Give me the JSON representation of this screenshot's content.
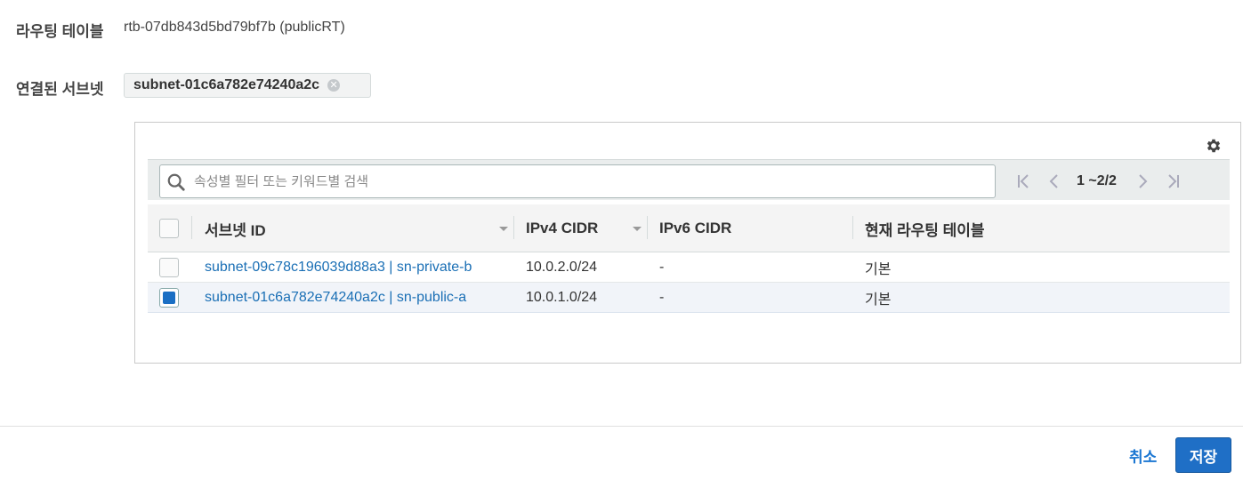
{
  "route_table": {
    "label": "라우팅 테이블",
    "value": "rtb-07db843d5bd79bf7b (publicRT)"
  },
  "associated_subnets": {
    "label": "연결된 서브넷",
    "token": "subnet-01c6a782e74240a2c"
  },
  "search": {
    "placeholder": "속성별 필터 또는 키워드별 검색",
    "value": ""
  },
  "pagination": {
    "text": "1 ~2/2"
  },
  "table": {
    "columns": [
      "서브넷 ID",
      "IPv4 CIDR",
      "IPv6 CIDR",
      "현재 라우팅 테이블"
    ],
    "rows": [
      {
        "subnet": "subnet-09c78c196039d88a3 | sn-private-b",
        "ipv4": "10.0.2.0/24",
        "ipv6": "-",
        "route_table": "기본",
        "checked": false
      },
      {
        "subnet": "subnet-01c6a782e74240a2c | sn-public-a",
        "ipv4": "10.0.1.0/24",
        "ipv6": "-",
        "route_table": "기본",
        "checked": true
      }
    ]
  },
  "footer": {
    "cancel_label": "취소",
    "save_label": "저장"
  },
  "icons": [
    "gear-icon",
    "search-icon",
    "first-page-icon",
    "prev-page-icon",
    "next-page-icon",
    "last-page-icon",
    "sort-caret-icon",
    "token-remove-icon"
  ],
  "colors": {
    "link": "#1a6fb5",
    "primary": "#1f6fc6",
    "checkbox_checked": "#1a6fc4",
    "selected_row": "#f1f4f9"
  }
}
